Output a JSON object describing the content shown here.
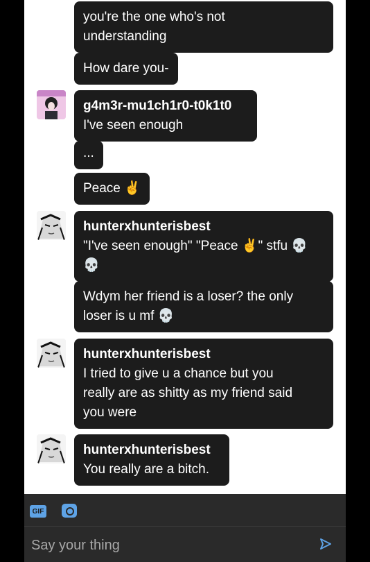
{
  "messages": [
    {
      "sender": "",
      "text": "you're the one who's not\nunderstanding"
    },
    {
      "sender": "",
      "text": "How dare you-"
    },
    {
      "sender": "g4m3r-mu1ch1r0-t0k1t0",
      "text": "I've seen enough"
    },
    {
      "sender": "",
      "text": "..."
    },
    {
      "sender": "",
      "text": "Peace ✌️"
    },
    {
      "sender": "hunterxhunterisbest",
      "text": "\"I've seen enough\" \"Peace ✌️\" stfu 💀\n💀"
    },
    {
      "sender": "",
      "text": "Wdym her friend is a loser? the only\nloser is u mf 💀"
    },
    {
      "sender": "hunterxhunterisbest",
      "text": "I tried to give u a chance but you\nreally are as shitty as my friend said\nyou were"
    },
    {
      "sender": "hunterxhunterisbest",
      "text": "You really are a bitch."
    }
  ],
  "composer": {
    "gif_label": "GIF",
    "placeholder": "Say your thing"
  },
  "colors": {
    "bubble": "#1c1c1c",
    "panel": "#ffffff",
    "composer": "#2a2a2a",
    "accent": "#5ea3e6"
  }
}
